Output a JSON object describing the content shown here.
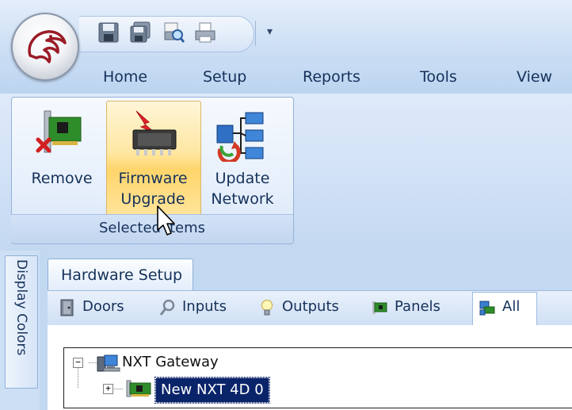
{
  "menu": {
    "items": [
      {
        "label": "Home"
      },
      {
        "label": "Setup"
      },
      {
        "label": "Reports"
      },
      {
        "label": "Tools"
      },
      {
        "label": "View"
      }
    ]
  },
  "ribbon": {
    "group_caption": "Selected Items",
    "buttons": {
      "remove": "Remove",
      "firmware_line1": "Firmware",
      "firmware_line2": "Upgrade",
      "update_line1": "Update",
      "update_line2": "Network"
    }
  },
  "side_tab": {
    "label": "Display Colors"
  },
  "document": {
    "tab_label": "Hardware Setup",
    "toolbar": [
      {
        "label": "Doors",
        "icon": "door-icon"
      },
      {
        "label": "Inputs",
        "icon": "input-icon"
      },
      {
        "label": "Outputs",
        "icon": "bulb-icon"
      },
      {
        "label": "Panels",
        "icon": "panel-icon"
      },
      {
        "label": "All",
        "icon": "network-icon"
      }
    ]
  },
  "tree": {
    "root": "NXT Gateway",
    "child": "New NXT 4D 0"
  },
  "colors": {
    "ribbon_blue": "#c3d8f1",
    "hover_orange": "#ffd56b",
    "selection": "#0a246a",
    "text": "#15315a"
  }
}
